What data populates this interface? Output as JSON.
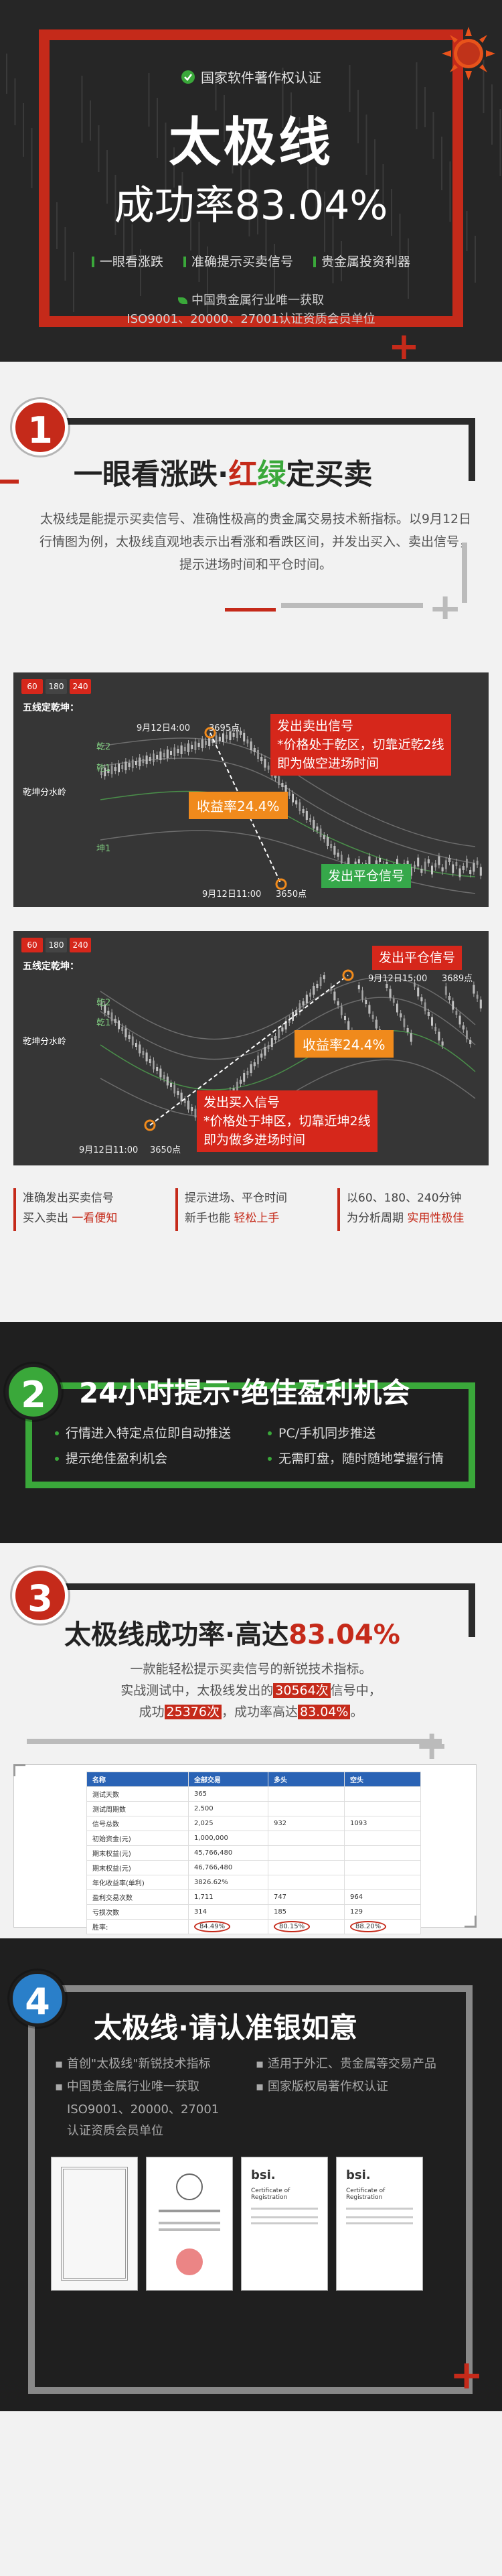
{
  "hero": {
    "cert_text": "国家软件著作权认证",
    "title": "太极线",
    "subtitle": "成功率83.04%",
    "features": [
      "一眼看涨跌",
      "准确提示买卖信号",
      "贵金属投资利器"
    ],
    "note1": "中国贵金属行业唯一获取",
    "note2": "ISO9001、20000、27001认证资质会员单位"
  },
  "s1": {
    "num": "1",
    "title_a": "一眼看涨跌·",
    "title_red": "红",
    "title_green": "绿",
    "title_b": "定买卖",
    "paragraph": "太极线是能提示买卖信号、准确性极高的贵金属交易技术新指标。以9月12日行情图为例，太极线直观地表示出看涨和看跌区间，并发出买入、卖出信号，提示进场时间和平仓时间。"
  },
  "chart1": {
    "tabs": [
      "60",
      "180",
      "240"
    ],
    "title": "五线定乾坤：",
    "level_top": "乾2",
    "level_mid": "乾1",
    "level_low": "坤1",
    "axis_label": "乾坤分水岭",
    "date_top": "9月12日4:00",
    "price_top": "3695点",
    "date_bottom": "9月12日11:00",
    "price_bottom": "3650点",
    "sell_signal": "发出卖出信号",
    "sell_detail1": "*价格处于乾区，切靠近乾2线",
    "sell_detail2": "即为做空进场时间",
    "profit": "收益率24.4%",
    "close_signal": "发出平仓信号"
  },
  "chart2": {
    "tabs": [
      "60",
      "180",
      "240"
    ],
    "title": "五线定乾坤：",
    "level_top": "乾2",
    "level_mid": "乾1",
    "axis_label": "乾坤分水岭",
    "date_top": "9月12日15:00",
    "price_top": "3689点",
    "date_bottom": "9月12日11:00",
    "price_bottom": "3650点",
    "close_signal": "发出平仓信号",
    "profit": "收益率24.4%",
    "buy_signal": "发出买入信号",
    "buy_detail1": "*价格处于坤区，切靠近坤2线",
    "buy_detail2": "即为做多进场时间"
  },
  "feat3": [
    {
      "line1": "准确发出买卖信号",
      "line2a": "买入卖出  ",
      "line2b": "一看便知"
    },
    {
      "line1": "提示进场、平仓时间",
      "line2a": "新手也能 ",
      "line2b": "轻松上手"
    },
    {
      "line1": "以60、180、240分钟",
      "line2a": "为分析周期 ",
      "line2b": "实用性极佳"
    }
  ],
  "s2": {
    "num": "2",
    "title": "24小时提示·绝佳盈利机会",
    "items": [
      "行情进入特定点位即自动推送",
      "PC/手机同步推送",
      "提示绝佳盈利机会",
      "无需盯盘，随时随地掌握行情"
    ]
  },
  "s3": {
    "num": "3",
    "title_a": "太极线成功率·高达",
    "title_pct": "83.04%",
    "line1": "一款能轻松提示买卖信号的新锐技术指标。",
    "line2a": "实战测试中，太极线发出的",
    "line2_hl": "30564次",
    "line2b": "信号中，",
    "line3a": "成功",
    "line3_hl": "25376次",
    "line3b": "，成功率高达",
    "line3_pct": "83.04%",
    "line3c": "。"
  },
  "table": {
    "headers": [
      "名称",
      "全部交易",
      "多头",
      "空头"
    ],
    "rows": [
      [
        "测试天数",
        "365",
        "",
        ""
      ],
      [
        "测试周期数",
        "2,500",
        "",
        ""
      ],
      [
        "信号总数",
        "2,025",
        "932",
        "1093"
      ],
      [
        "初始资金(元)",
        "1,000,000",
        "",
        ""
      ],
      [
        "期末权益(元)",
        "45,766,480",
        "",
        ""
      ],
      [
        "期末权益(元)",
        "46,766,480",
        "",
        ""
      ],
      [
        "年化收益率(单利)",
        "3826.62%",
        "",
        ""
      ],
      [
        "盈利交易次数",
        "1,711",
        "747",
        "964"
      ],
      [
        "亏损次数",
        "314",
        "185",
        "129"
      ]
    ],
    "rate_label": "胜率:",
    "rate_all": "84.49%",
    "rate_long": "80.15%",
    "rate_short": "88.20%"
  },
  "s4": {
    "num": "4",
    "title": "太极线·请认准银如意",
    "items": [
      "首创\"太极线\"新锐技术指标",
      "适用于外汇、贵金属等交易产品",
      "中国贵金属行业唯一获取",
      "国家版权局著作权认证",
      "ISO9001、20000、27001",
      "认证资质会员单位"
    ],
    "certs": [
      "",
      "",
      "bsi.",
      "bsi."
    ],
    "cert_caption": "Certificate of Registration"
  },
  "colors": {
    "red": "#c52a1a",
    "green": "#3aa83a",
    "orange": "#f08a1c",
    "blue": "#2a7fc9",
    "dark": "#1f1f1f"
  }
}
